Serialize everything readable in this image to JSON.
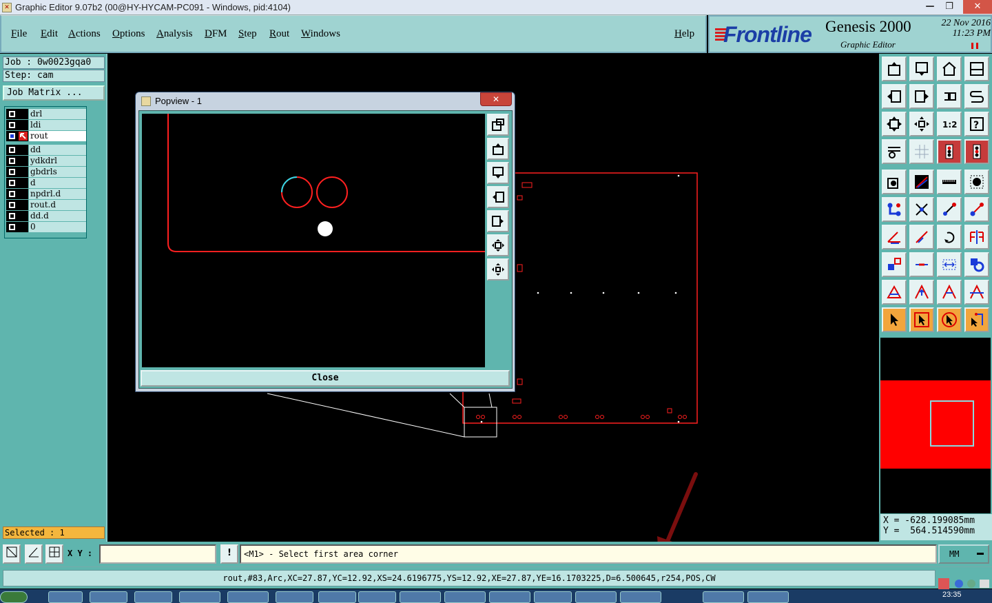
{
  "window": {
    "title": "Graphic Editor 9.07b2 (00@HY-HYCAM-PC091 - Windows, pid:4104)",
    "min_label": "—",
    "max_label": "❐",
    "close_label": "✕"
  },
  "menu": [
    "File",
    "Edit",
    "Actions",
    "Options",
    "Analysis",
    "DFM",
    "Step",
    "Rout",
    "Windows"
  ],
  "help_label": "Help",
  "brand": {
    "logo": "Frontline",
    "product": "Genesis 2000",
    "subtitle": "Graphic Editor",
    "date": "22 Nov 2016",
    "time": "11:23 PM"
  },
  "job": {
    "job_label": "Job : 0w0023gqa0",
    "step_label": "Step: cam",
    "matrix_button": "Job Matrix ..."
  },
  "layers": {
    "primary": [
      {
        "name": "drl",
        "active": false
      },
      {
        "name": "ldi",
        "active": false
      },
      {
        "name": "rout",
        "active": true
      }
    ],
    "secondary": [
      "dd",
      "ydkdrl",
      "gbdrls",
      "d",
      "npdrl.d",
      "rout.d",
      "dd.d",
      "0"
    ]
  },
  "selected": "Selected : 1",
  "popview": {
    "title": "Popview - 1",
    "close_x": "✕",
    "close_button": "Close"
  },
  "coords": {
    "x": "X = -628.199085mm",
    "y": "Y =  564.514590mm"
  },
  "command": {
    "xy_label": "X Y :",
    "xy_value": "",
    "warn_label": "!",
    "prompt": "<M1> - Select first area corner",
    "units": "MM"
  },
  "status_text": "rout,#83,Arc,XC=27.87,YC=12.92,XS=24.6196775,YS=12.92,XE=27.87,YE=16.1703225,D=6.500645,r254,POS,CW",
  "tray": {
    "time": "23:35"
  },
  "colors": {
    "panel": "#5fb5ae",
    "field": "#bfe5e3",
    "accent": "#d81e1e",
    "outline": "#ff2020"
  }
}
